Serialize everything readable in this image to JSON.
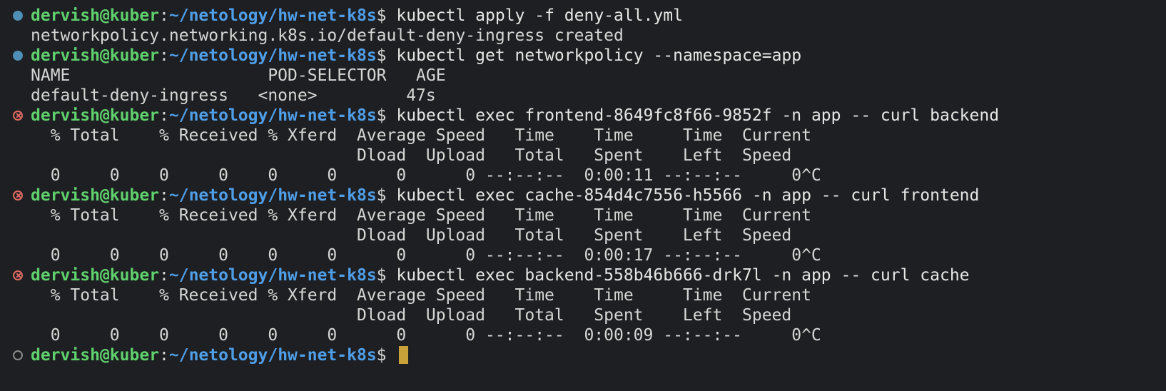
{
  "prompt": {
    "user": "dervish@kuber",
    "colon": ":",
    "path": "~/netology/hw-net-k8s",
    "dollar": "$ "
  },
  "blocks": [
    {
      "status": "success",
      "command": "kubectl apply -f deny-all.yml",
      "output": [
        "networkpolicy.networking.k8s.io/default-deny-ingress created"
      ]
    },
    {
      "status": "success",
      "command": "kubectl get networkpolicy --namespace=app",
      "output": [
        "NAME                    POD-SELECTOR   AGE",
        "default-deny-ingress   <none>         47s"
      ]
    },
    {
      "status": "error",
      "command": "kubectl exec frontend-8649fc8f66-9852f -n app -- curl backend",
      "output": [
        "  % Total    % Received % Xferd  Average Speed   Time    Time     Time  Current",
        "                                 Dload  Upload   Total   Spent    Left  Speed",
        "  0     0    0     0    0     0      0      0 --:--:--  0:00:11 --:--:--     0^C"
      ]
    },
    {
      "status": "error",
      "command": "kubectl exec cache-854d4c7556-h5566 -n app -- curl frontend",
      "output": [
        "  % Total    % Received % Xferd  Average Speed   Time    Time     Time  Current",
        "                                 Dload  Upload   Total   Spent    Left  Speed",
        "  0     0    0     0    0     0      0      0 --:--:--  0:00:17 --:--:--     0^C"
      ]
    },
    {
      "status": "error",
      "command": "kubectl exec backend-558b46b666-drk7l -n app -- curl cache",
      "output": [
        "  % Total    % Received % Xferd  Average Speed   Time    Time     Time  Current",
        "                                 Dload  Upload   Total   Spent    Left  Speed",
        "  0     0    0     0    0     0      0      0 --:--:--  0:00:09 --:--:--     0^C"
      ]
    },
    {
      "status": "idle",
      "command": "",
      "output": [],
      "cursor": true
    }
  ],
  "status_icons": {
    "success": "filled-circle-icon",
    "error": "circle-x-icon",
    "idle": "hollow-circle-icon"
  },
  "colors": {
    "background": "#1e1f22",
    "user": "#5fd16d",
    "path": "#4f9ee8",
    "text": "#d6d6d6",
    "success_marker": "#4f8fb6",
    "error_marker": "#e06b64",
    "idle_marker": "#8a8a8a",
    "cursor": "#c9a23a"
  }
}
